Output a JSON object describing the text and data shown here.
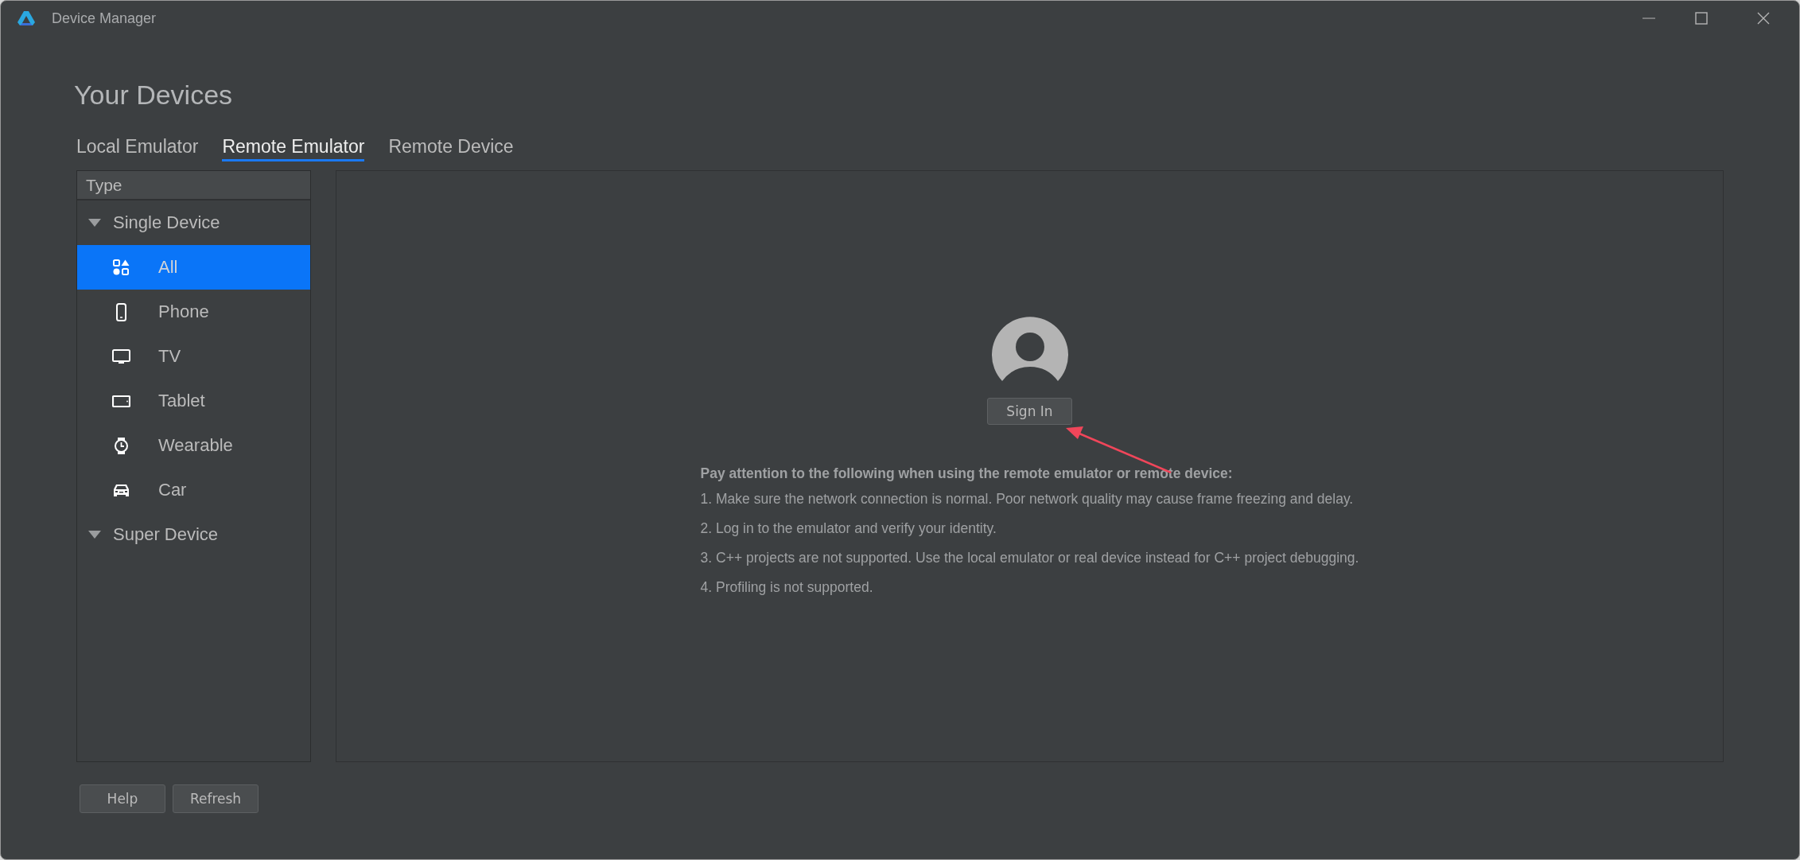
{
  "window": {
    "title": "Device Manager"
  },
  "heading": "Your Devices",
  "tabs": [
    {
      "label": "Local Emulator",
      "selected": false
    },
    {
      "label": "Remote Emulator",
      "selected": true
    },
    {
      "label": "Remote Device",
      "selected": false
    }
  ],
  "sidebar": {
    "header": "Type",
    "groups": [
      {
        "label": "Single Device",
        "expanded": true,
        "children": [
          {
            "label": "All",
            "kind": "all",
            "selected": true
          },
          {
            "label": "Phone",
            "kind": "phone",
            "selected": false
          },
          {
            "label": "TV",
            "kind": "tv",
            "selected": false
          },
          {
            "label": "Tablet",
            "kind": "tablet",
            "selected": false
          },
          {
            "label": "Wearable",
            "kind": "watch",
            "selected": false
          },
          {
            "label": "Car",
            "kind": "car",
            "selected": false
          }
        ]
      },
      {
        "label": "Super Device",
        "expanded": true
      }
    ]
  },
  "sign_in": {
    "button": "Sign In"
  },
  "notice": {
    "title": "Pay attention to the following when using the remote emulator or remote device:",
    "items": [
      "1. Make sure the network connection is normal. Poor network quality may cause frame freezing and delay.",
      "2. Log in to the emulator and verify your identity.",
      "3. C++ projects are not supported. Use the local emulator or real device instead for C++ project debugging.",
      "4. Profiling is not supported."
    ]
  },
  "buttons": [
    "Help",
    "Refresh"
  ]
}
